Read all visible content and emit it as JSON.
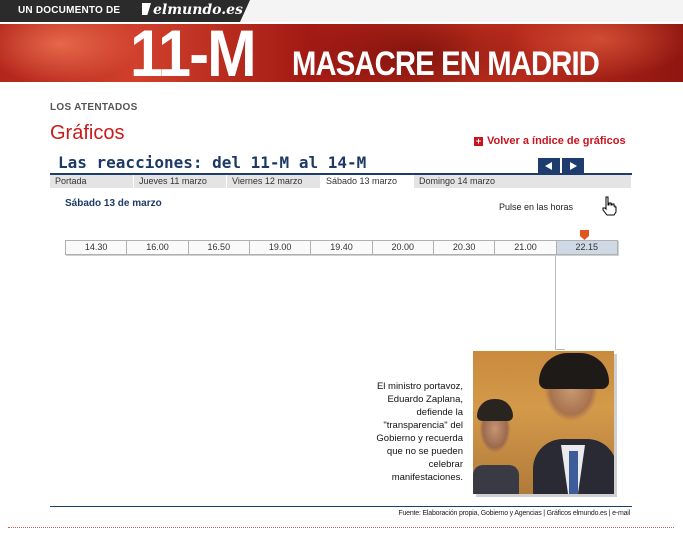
{
  "header": {
    "doc_label": "UN DOCUMENTO DE",
    "logo_text": "elmundo.es",
    "banner_tag": "11-M",
    "banner_title": "MASACRE EN MADRID"
  },
  "section": {
    "label": "LOS ATENTADOS",
    "title": "Gráficos"
  },
  "back_link": "Volver a índice de gráficos",
  "graphic": {
    "title": "Las reacciones: del 11-M al 14-M",
    "tabs": [
      "Portada",
      "Jueves 11 marzo",
      "Viernes 12 marzo",
      "Sábado 13 marzo",
      "Domingo 14 marzo"
    ],
    "active_tab": "Sábado 13 marzo",
    "date_heading": "Sábado 13 de marzo",
    "instruction": "Pulse en las horas",
    "times": [
      "14.30",
      "16.00",
      "16.50",
      "19.00",
      "19.40",
      "20.00",
      "20.30",
      "21.00",
      "22.15"
    ],
    "active_time": "22.15",
    "caption": "El ministro portavoz, Eduardo Zaplana, defiende la \"transparencia\" del Gobierno y recuerda que no se pueden celebrar manifestaciones."
  },
  "footer": {
    "source": "Fuente: Elaboración propia, Gobierno y Agencias | Gráficos elmundo.es | e-mail"
  },
  "colors": {
    "accent_red": "#cc1a1a",
    "navy": "#1d3a66",
    "marker_orange": "#e0561e"
  },
  "icons": [
    "plus-icon",
    "arrow-left-icon",
    "arrow-right-icon",
    "hand-pointer-icon"
  ]
}
